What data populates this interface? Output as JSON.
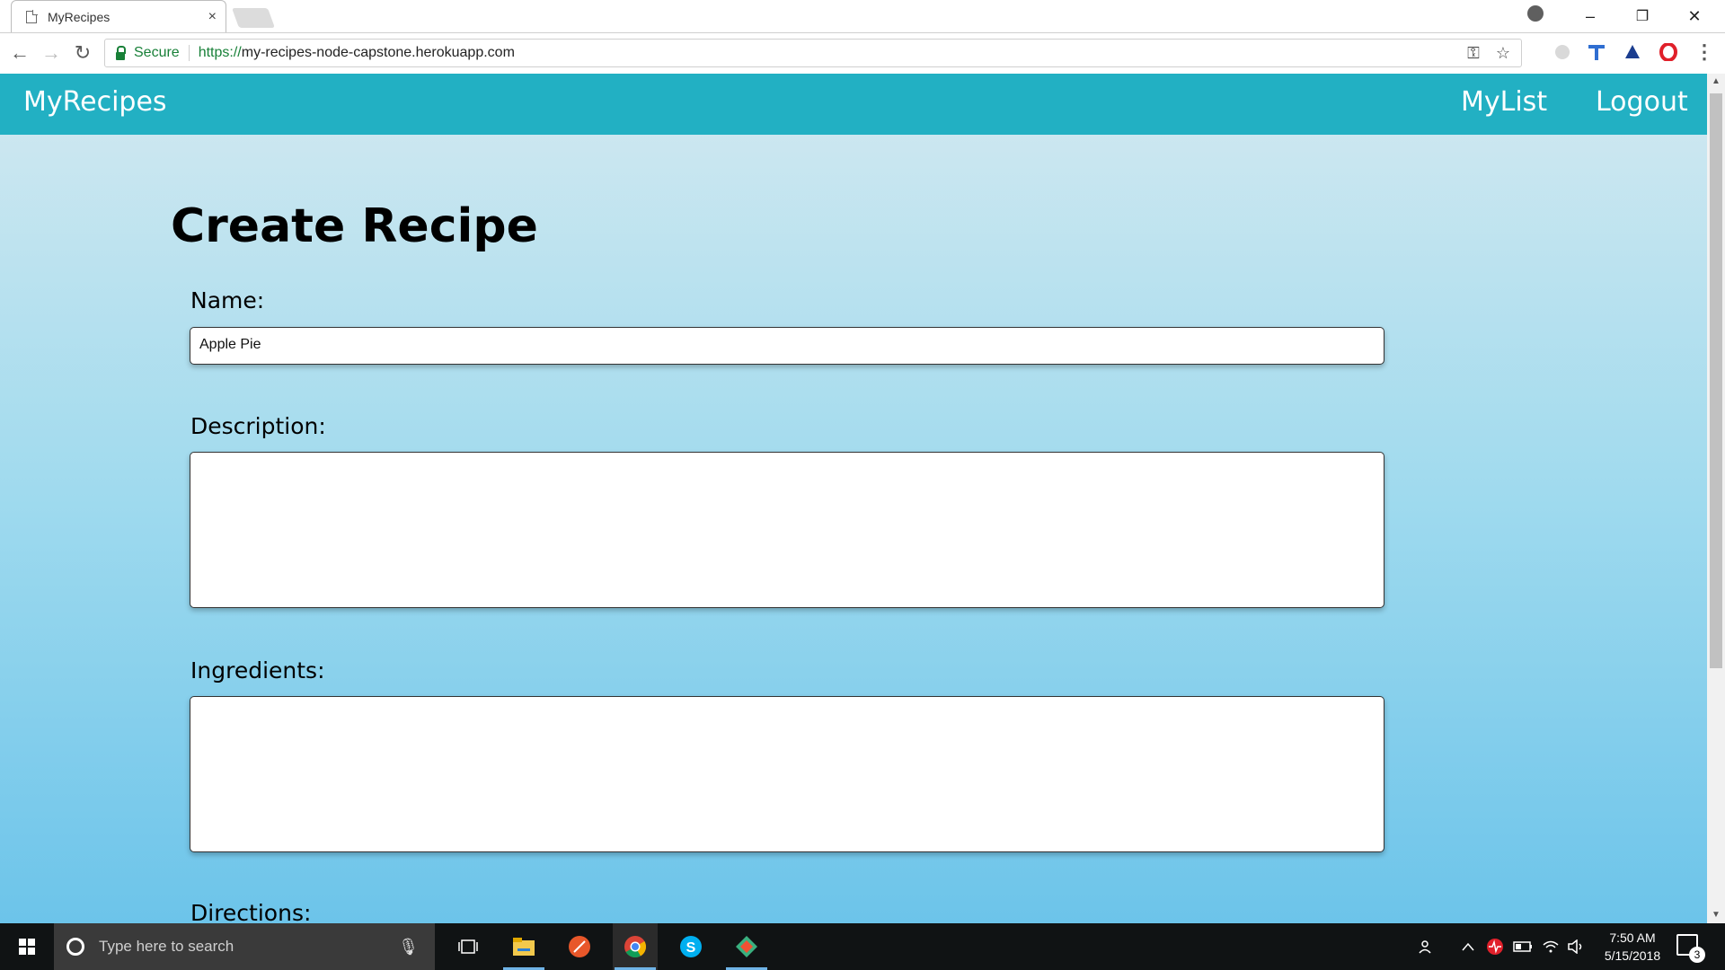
{
  "browser": {
    "tab_title": "MyRecipes",
    "tab_close": "×",
    "secure_label": "Secure",
    "url_scheme": "https://",
    "url_host": "my-recipes-node-capstone.herokuapp.com",
    "window_controls": {
      "minimize": "–",
      "restore": "❐",
      "close": "✕"
    },
    "nav": {
      "back": "←",
      "forward": "→",
      "reload": "↻"
    },
    "omni_icons": {
      "key": "⚿",
      "star": "☆"
    },
    "menu_icon": "⋮"
  },
  "site": {
    "brand": "MyRecipes",
    "nav_links": [
      "MyList",
      "Logout"
    ]
  },
  "form": {
    "title": "Create Recipe",
    "fields": {
      "name": {
        "label": "Name:",
        "value": "Apple Pie"
      },
      "description": {
        "label": "Description:",
        "value": ""
      },
      "ingredients": {
        "label": "Ingredients:",
        "value": ""
      },
      "directions": {
        "label": "Directions:"
      }
    }
  },
  "taskbar": {
    "search_placeholder": "Type here to search",
    "time": "7:50 AM",
    "date": "5/15/2018",
    "notification_count": "3"
  }
}
